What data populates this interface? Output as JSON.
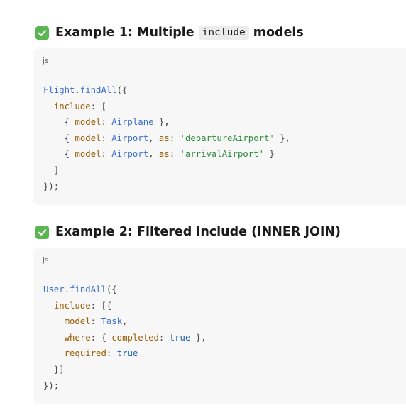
{
  "example1": {
    "title_prefix": "Example 1: Multiple",
    "title_code": "include",
    "title_suffix": "models",
    "lang": "js",
    "code": {
      "l1_obj": "Flight",
      "l1_fn": "findAll",
      "key_include": "include",
      "key_model": "model",
      "key_as": "as",
      "m1": "Airplane",
      "m2": "Airport",
      "a2": "'departureAirport'",
      "m3": "Airport",
      "a3": "'arrivalAirport'"
    }
  },
  "example2": {
    "title": "Example 2: Filtered include (INNER JOIN)",
    "lang": "js",
    "code": {
      "l1_obj": "User",
      "l1_fn": "findAll",
      "key_include": "include",
      "key_model": "model",
      "model_val": "Task",
      "key_where": "where",
      "key_completed": "completed",
      "completed_val": "true",
      "key_required": "required",
      "required_val": "true"
    }
  },
  "colors": {
    "check_green": "#5ab552",
    "code_bg": "#f7f7f7",
    "key": "#9a5b00",
    "ident": "#3b6fc9",
    "string": "#2e8a3a"
  },
  "icons": {
    "heading_icon": "check-box-icon"
  }
}
